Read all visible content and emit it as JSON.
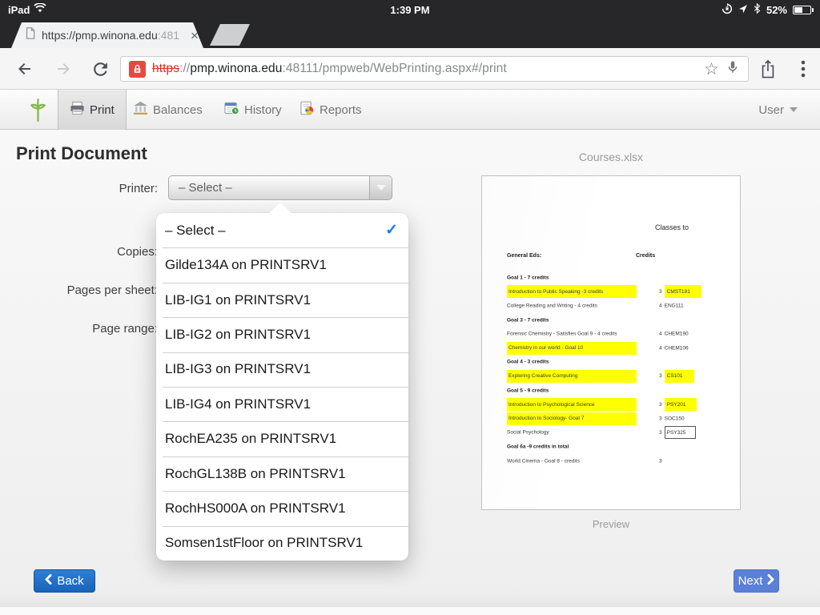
{
  "status": {
    "carrier": "iPad",
    "time": "1:39 PM",
    "battery_pct": "52%"
  },
  "tabbar": {
    "tab_title": "https://pmp.winona.edu",
    "tab_title_fade": ":481",
    "close_glyph": "×"
  },
  "urlbar": {
    "scheme": "https",
    "sep": "://",
    "domain": "pmp.winona.edu",
    "path": ":48111/pmpweb/WebPrinting.aspx#/print",
    "star_glyph": "☆"
  },
  "nav": {
    "print": "Print",
    "balances": "Balances",
    "history": "History",
    "reports": "Reports",
    "user": "User"
  },
  "main": {
    "title": "Print Document"
  },
  "form": {
    "printer_label": "Printer:",
    "printer_value": "– Select –",
    "copies_label": "Copies:",
    "pps_label": "Pages per sheet:",
    "range_label": "Page range:"
  },
  "dropdown": {
    "check_glyph": "✓",
    "items": [
      "– Select –",
      "Gilde134A on PRINTSRV1",
      "LIB-IG1 on PRINTSRV1",
      "LIB-IG2 on PRINTSRV1",
      "LIB-IG3 on PRINTSRV1",
      "LIB-IG4 on PRINTSRV1",
      "RochEA235 on PRINTSRV1",
      "RochGL138B on PRINTSRV1",
      "RochHS000A on PRINTSRV1",
      "Somsen1stFloor on PRINTSRV1"
    ]
  },
  "preview": {
    "filename": "Courses.xlsx",
    "caption": "Preview",
    "doc_title": "Classes to",
    "col_left": "General Eds:",
    "col_right": "Credits",
    "rows": [
      {
        "text": "Goal 1 - 7 credits",
        "bold": true
      },
      {
        "text": "Introduction to Public Speaking -3 credits",
        "hl": true,
        "credit": "3",
        "code": "CMST191",
        "code_hl": true
      },
      {
        "text": "College Reading and Writing - 4 credits",
        "credit": "4",
        "code": "ENG111"
      },
      {
        "text": "Goal 3 - 7 credits",
        "bold": true
      },
      {
        "text": "Forensic Chemistry - Satisfies Goal 9 - 4 credits",
        "credit": "4",
        "code": "CHEM190"
      },
      {
        "text": "Chemistry in our world - Goal 10",
        "hl": true,
        "credit": "4",
        "code": "CHEM106"
      },
      {
        "text": "Goal 4 - 3 credits",
        "bold": true
      },
      {
        "text": "Exploring Creative Computing",
        "hl": true,
        "credit": "3",
        "code": "CS101",
        "code_hl": true
      },
      {
        "text": "Goal 5 - 9 credits",
        "bold": true
      },
      {
        "text": "Introduction to Psychological Science",
        "hl": true,
        "credit": "3",
        "code": "PSY201",
        "code_hl": true
      },
      {
        "text": "Introduction to Sociology- Goal 7",
        "hl": true,
        "credit": "3",
        "code": "SOC150"
      },
      {
        "text": "Social Psychology",
        "credit": "3",
        "code": "PSY325",
        "boxed": true
      },
      {
        "text": "Goal 6a -9 credits in total",
        "bold": true
      },
      {
        "text": "World Cinema - Goal 8 - credits",
        "credit": "3"
      }
    ]
  },
  "footer": {
    "back": "Back",
    "next": "Next"
  },
  "colors": {
    "back_button": "#1b67bf",
    "next_button": "#5b80d8",
    "highlight": "#ffff00",
    "check_blue": "#0b7bff",
    "insecure_red": "#e5493f",
    "chrome_dark": "#27272a"
  }
}
